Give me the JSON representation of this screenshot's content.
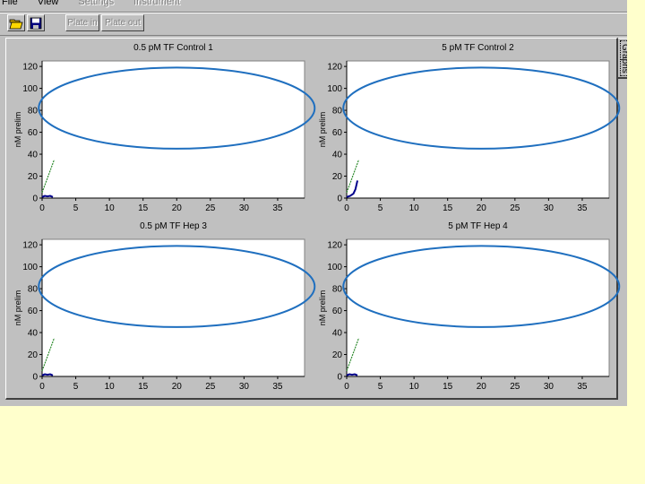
{
  "menu": {
    "items": [
      {
        "label": "File",
        "enabled": true
      },
      {
        "label": "View",
        "enabled": true
      },
      {
        "label": "Settings",
        "enabled": false
      },
      {
        "label": "Instrument",
        "enabled": false
      }
    ]
  },
  "toolbar": {
    "open_icon": "folder-open-icon",
    "save_icon": "floppy-disk-icon",
    "plate_in_label": "Plate in",
    "plate_out_label": "Plate out"
  },
  "side_tab": {
    "label": "Graphs"
  },
  "colors": {
    "background": "#ffffcc",
    "window": "#c0c0c0",
    "ellipse": "#1f6fbf",
    "trace_green": "#2e8b2e",
    "trace_navy": "#00008b"
  },
  "graphs": [
    {
      "title": "0.5 pM TF Control 1",
      "ylabel": "nM prelim",
      "trace": "flat"
    },
    {
      "title": "5 pM TF Control 2",
      "ylabel": "nM prelim",
      "trace": "rise"
    },
    {
      "title": "0.5 pM TF Hep 3",
      "ylabel": "nM prelim",
      "trace": "flat"
    },
    {
      "title": "5 pM TF Hep 4",
      "ylabel": "nM prelim",
      "trace": "flat"
    }
  ],
  "chart_data": {
    "type": "line",
    "x_ticks": [
      0,
      5,
      10,
      15,
      20,
      25,
      30,
      35
    ],
    "y_ticks": [
      0,
      20,
      40,
      60,
      80,
      100,
      120
    ],
    "xlim": [
      0,
      39
    ],
    "ylim": [
      0,
      125
    ],
    "grid": false,
    "series_curve": {
      "cx": 20,
      "cy": 82,
      "rx": 20.5,
      "ry": 37,
      "green_line": {
        "x": [
          0,
          1.8
        ],
        "y": [
          5,
          35
        ]
      },
      "navy_flat": {
        "x": [
          0,
          0.4,
          0.8,
          1.2,
          1.6
        ],
        "y": [
          1,
          2,
          1.5,
          2,
          1
        ]
      },
      "navy_rise": {
        "x": [
          0,
          0.5,
          1,
          1.3,
          1.6
        ],
        "y": [
          1,
          2,
          4,
          8,
          16
        ]
      }
    }
  }
}
